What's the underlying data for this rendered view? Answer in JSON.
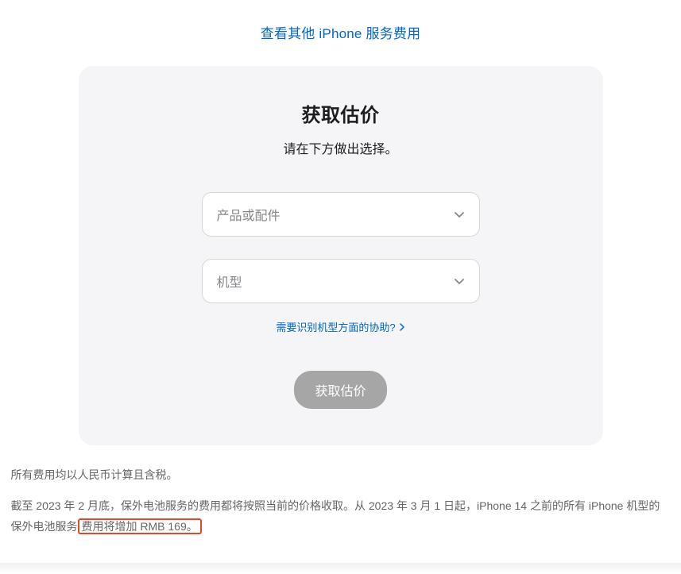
{
  "topLink": {
    "label": "查看其他 iPhone 服务费用"
  },
  "card": {
    "title": "获取估价",
    "subtitle": "请在下方做出选择。",
    "productSelect": {
      "placeholder": "产品或配件"
    },
    "modelSelect": {
      "placeholder": "机型"
    },
    "helpLink": {
      "label": "需要识别机型方面的协助?"
    },
    "submit": {
      "label": "获取估价"
    }
  },
  "footnotes": {
    "line1": "所有费用均以人民币计算且含税。",
    "line2_pre": "截至 2023 年 2 月底，保外电池服务的费用都将按照当前的价格收取。从 2023 年 3 月 1 日起，iPhone 14 之前的所有 iPhone 机型的保外电池服务",
    "line2_highlight": "费用将增加 RMB 169。"
  }
}
